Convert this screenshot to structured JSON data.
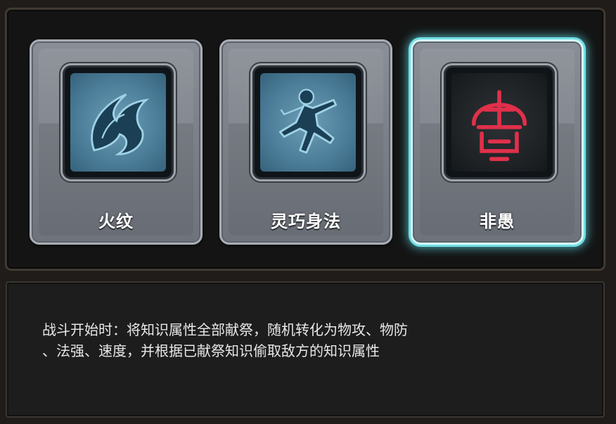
{
  "skills": [
    {
      "name": "火纹",
      "icon": "flame-swirl-icon",
      "selected": false
    },
    {
      "name": "灵巧身法",
      "icon": "leaping-figure-icon",
      "selected": false
    },
    {
      "name": "非愚",
      "icon": "red-rune-icon",
      "selected": true
    }
  ],
  "description": "战斗开始时：将知识属性全部献祭，随机转化为物攻、物防\n、法强、速度，并根据已献祭知识偷取敌方的知识属性",
  "colors": {
    "selected_glow": "#6fe0e6",
    "icon_blue": "#1b3f55",
    "rune_red": "#e0304a",
    "text": "#e8e8e8"
  }
}
